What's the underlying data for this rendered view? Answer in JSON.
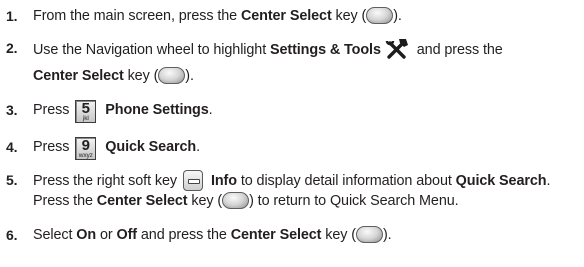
{
  "steps": [
    {
      "number": "1.",
      "text_a": "From the main screen, press the ",
      "bold_a": "Center Select",
      "text_b": " key (",
      "text_c": ")."
    },
    {
      "number": "2.",
      "text_a": "Use the Navigation wheel to highlight ",
      "bold_a": "Settings & Tools",
      "text_b": " and press the ",
      "bold_b": "Center Select",
      "text_c": " key (",
      "text_d": ")."
    },
    {
      "number": "3.",
      "text_a": "Press",
      "key_digit": "5",
      "key_letters": "jkl",
      "bold_a": "Phone Settings",
      "text_b": "."
    },
    {
      "number": "4.",
      "text_a": "Press",
      "key_digit": "9",
      "key_letters": "wxyz",
      "bold_a": "Quick Search",
      "text_b": "."
    },
    {
      "number": "5.",
      "text_a": "Press the right soft key",
      "bold_a": "Info",
      "text_b": " to display detail information about ",
      "bold_b": "Quick Search",
      "text_c": ". Press the ",
      "bold_c": "Center Select",
      "text_d": " key (",
      "text_e": ") to return to Quick Search Menu."
    },
    {
      "number": "6.",
      "text_a": "Select ",
      "bold_a": "On",
      "text_b": " or ",
      "bold_b": "Off",
      "text_c": " and press the ",
      "bold_c": "Center Select",
      "text_d": " key (",
      "text_e": ")."
    }
  ],
  "icons": {
    "center_select": "center-select-key-icon",
    "settings_tools": "settings-tools-icon",
    "keypad": "keypad-key-icon",
    "right_soft_key": "right-soft-key-icon"
  }
}
